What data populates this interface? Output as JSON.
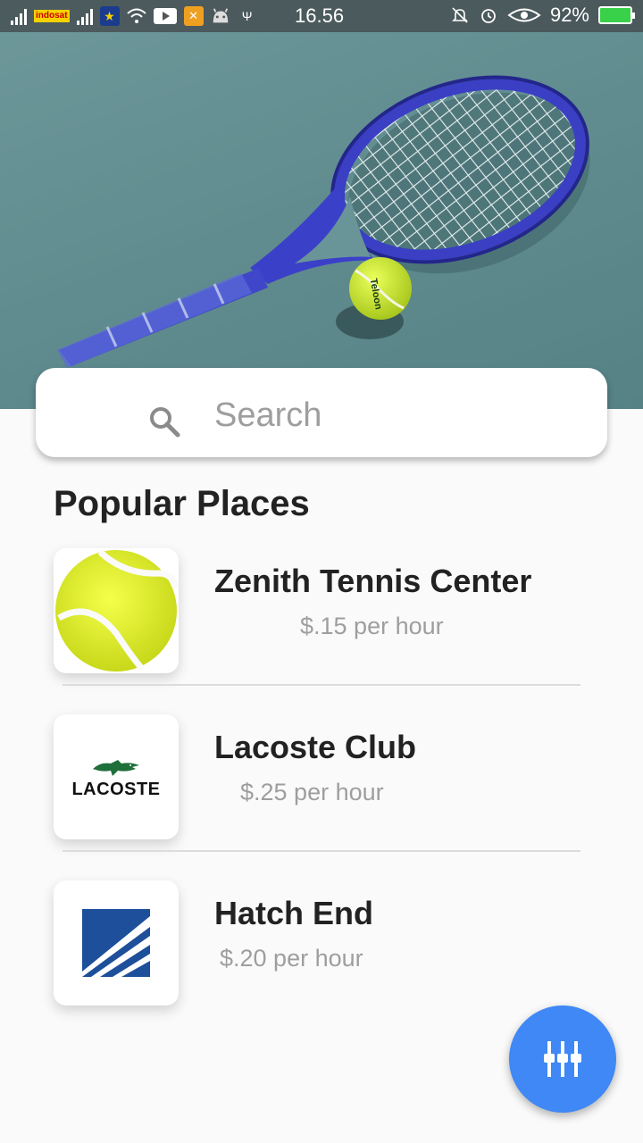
{
  "status_bar": {
    "carrier": "indosat",
    "time": "16.56",
    "battery": "92%",
    "icons": [
      "signal-icon",
      "wifi-icon",
      "youtube-icon",
      "app-icon",
      "android-icon",
      "usb-icon",
      "mute-icon",
      "alarm-icon",
      "eye-icon",
      "battery-icon"
    ]
  },
  "hero": {
    "image": "tennis-racket-and-ball-photo"
  },
  "search": {
    "placeholder": "Search",
    "value": ""
  },
  "section_title": "Popular Places",
  "places": [
    {
      "name": "Zenith Tennis Center",
      "price": "$.15 per hour",
      "logo": "tennis-ball"
    },
    {
      "name": "Lacoste Club",
      "price": "$.25 per hour",
      "logo": "lacoste",
      "logo_text": "LACOSTE"
    },
    {
      "name": "Hatch End",
      "price": "$.20 per hour",
      "logo": "hatch-end"
    }
  ],
  "fab": {
    "icon": "equalizer-filter-icon"
  },
  "colors": {
    "accent": "#3f88f5",
    "background": "#fafafa",
    "court": "#5d8a8d",
    "text": "#222222",
    "muted": "#9e9e9e"
  }
}
